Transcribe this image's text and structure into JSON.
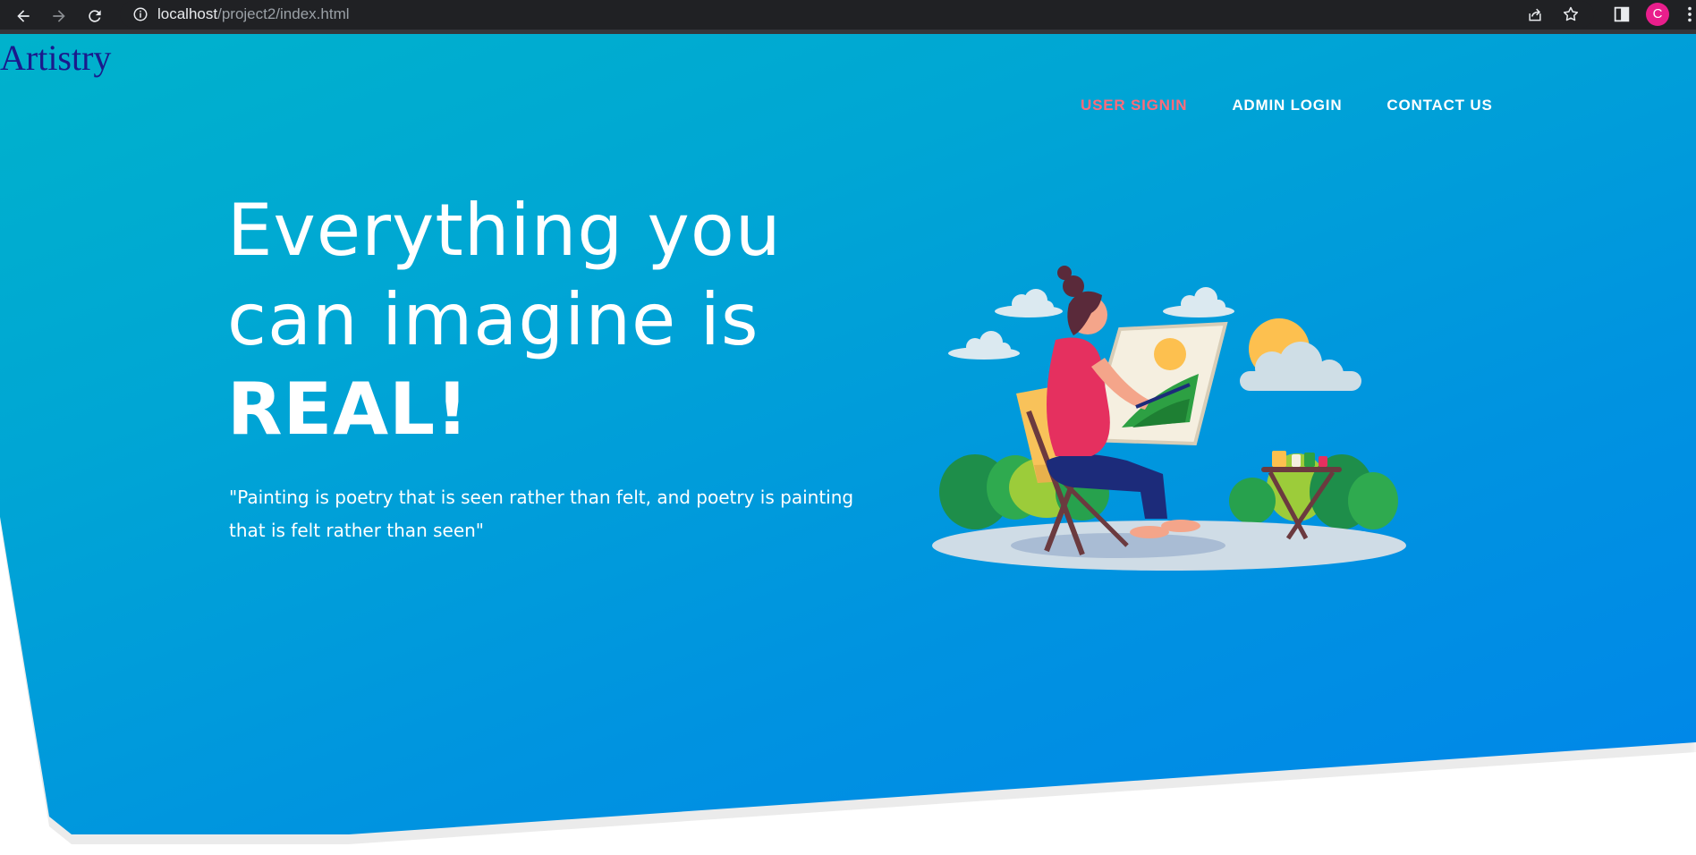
{
  "browser": {
    "url_host": "localhost",
    "url_path": "/project2/index.html",
    "profile_initial": "C",
    "icons": [
      "back-arrow-icon",
      "forward-arrow-icon",
      "reload-icon",
      "info-icon",
      "share-icon",
      "star-icon",
      "side-panel-icon",
      "kebab-menu-icon"
    ]
  },
  "site": {
    "logo": "Artistry",
    "nav": [
      {
        "label": "USER SIGNIN",
        "active": true
      },
      {
        "label": "ADMIN LOGIN",
        "active": false
      },
      {
        "label": "CONTACT US",
        "active": false
      }
    ]
  },
  "hero": {
    "headline_line1": "Everything you",
    "headline_line2": "can imagine is",
    "headline_emphasis": "REAL!",
    "quote_line1": "\"Painting is poetry that is seen rather than felt, and poetry is painting",
    "quote_line2": "that is felt rather than seen\"",
    "illustration": "woman-painting-outdoors-illustration"
  },
  "colors": {
    "hero_start": "#00b2cc",
    "hero_end": "#0085ea",
    "logo": "#1a1a8c",
    "nav_active": "#ff6b7a",
    "nav_default": "#ffffff",
    "chrome_bg": "#202124"
  }
}
